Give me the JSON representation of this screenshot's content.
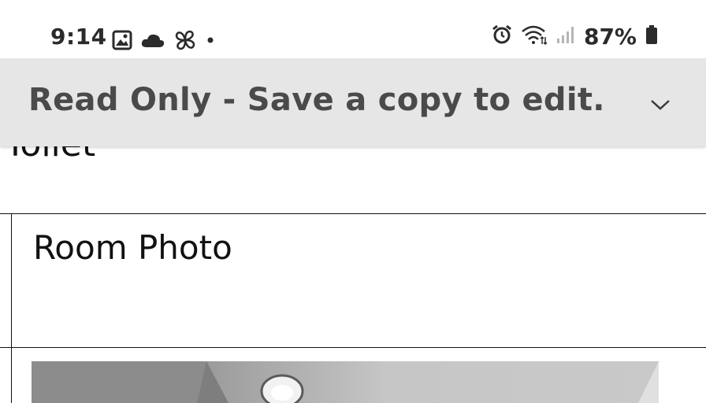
{
  "status_bar": {
    "time": "9:14",
    "battery_percent": "87%",
    "left_icons": [
      "gallery-icon",
      "cloud-icon",
      "pinwheel-icon",
      "dot-icon"
    ],
    "right_icons": [
      "alarm-icon",
      "wifi-icon",
      "signal-icon",
      "battery-icon"
    ]
  },
  "banner": {
    "text": "Read Only - Save a copy to edit.",
    "icon": "chevron-down-icon",
    "background": "#e6e6e6",
    "text_color": "#4a4a4a"
  },
  "document": {
    "partial_text": "Toilet",
    "room_photo_label": "Room Photo"
  }
}
